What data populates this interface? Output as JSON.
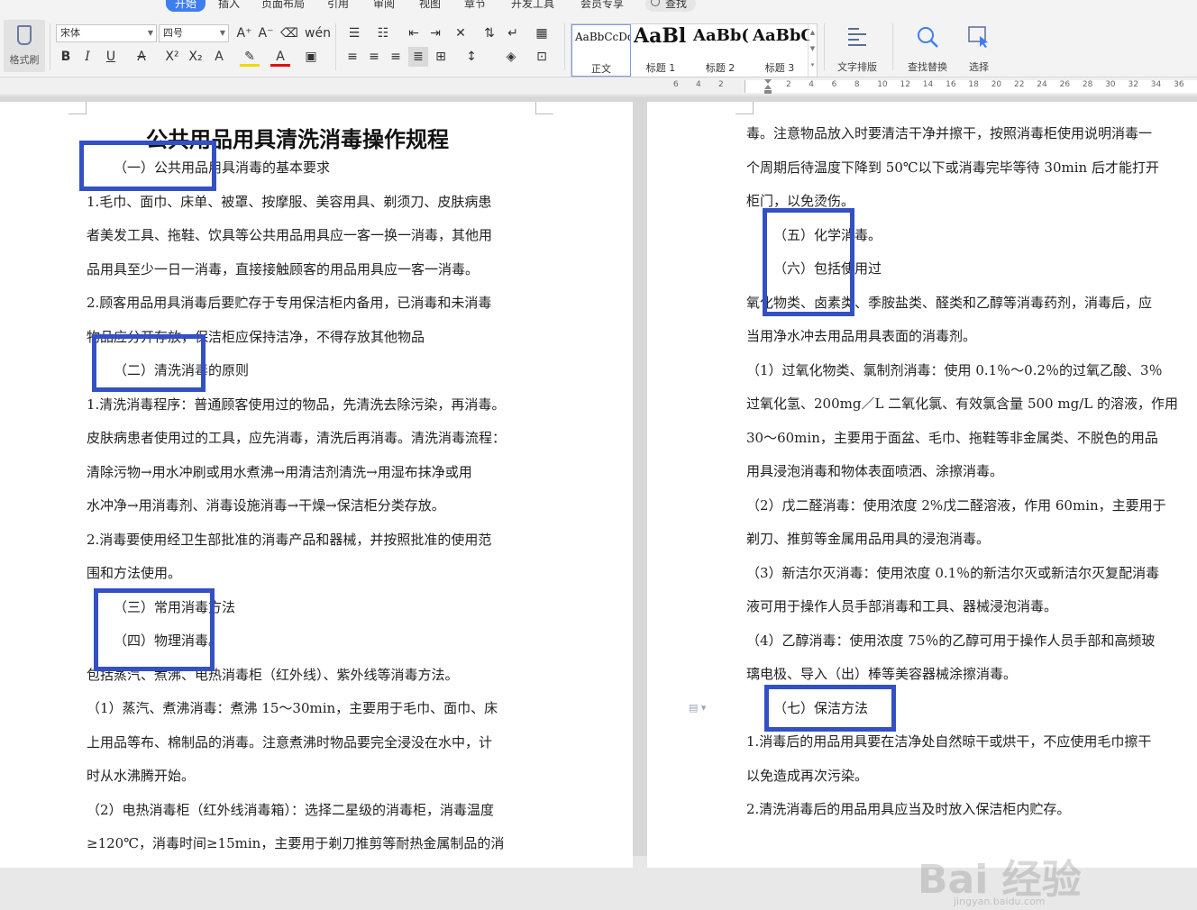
{
  "menu": {
    "tabs": [
      "开始",
      "插入",
      "页面布局",
      "引用",
      "审阅",
      "视图",
      "章节",
      "开发工具",
      "会员专享"
    ],
    "active_tab": "开始",
    "search_label": "查找"
  },
  "ribbon": {
    "format_painter": "格式刷",
    "font_name": "宋体",
    "font_size": "四号",
    "styles": [
      {
        "sample": "AaBbCcDd",
        "name": "正文"
      },
      {
        "sample": "AaBl",
        "name": "标题 1"
      },
      {
        "sample": "AaBb(",
        "name": "标题 2"
      },
      {
        "sample": "AaBbC",
        "name": "标题 3"
      }
    ],
    "text_layout": "文字排版",
    "find_replace": "查找替换",
    "select": "选择"
  },
  "ruler": {
    "left_numbers": [
      "6",
      "4",
      "2"
    ],
    "right_numbers": [
      "2",
      "4",
      "6",
      "8",
      "10",
      "12",
      "14",
      "16",
      "18",
      "20",
      "22",
      "24",
      "26",
      "28",
      "30",
      "32",
      "34",
      "36",
      "38"
    ]
  },
  "doc": {
    "title": "公共用品用具清洗消毒操作规程",
    "left_lines": [
      "（一）公共用品用具消毒的基本要求",
      "1.毛巾、面巾、床单、被罩、按摩服、美容用具、剃须刀、皮肤病患",
      "者美发工具、拖鞋、饮具等公共用品用具应一客一换一消毒，其他用",
      "品用具至少一日一消毒，直接接触顾客的用品用具应一客一消毒。",
      "2.顾客用品用具消毒后要贮存于专用保洁柜内备用，已消毒和未消毒",
      "物品应分开存放，保洁柜应保持洁净，不得存放其他物品",
      "（二）清洗消毒的原则",
      "1.清洗消毒程序：普通顾客使用过的物品，先清洗去除污染，再消毒。",
      "皮肤病患者使用过的工具，应先消毒，清洗后再消毒。清洗消毒流程：",
      "清除污物→用水冲刷或用水煮沸→用清洁剂清洗→用湿布抹净或用",
      "水冲净→用消毒剂、消毒设施消毒→干燥→保洁柜分类存放。",
      "2.消毒要使用经卫生部批准的消毒产品和器械，并按照批准的使用范",
      "围和方法使用。",
      "（三）常用消毒方法",
      "（四）物理消毒。",
      "包括蒸汽、煮沸、电热消毒柜（红外线）、紫外线等消毒方法。",
      "（1）蒸汽、煮沸消毒：煮沸 15～30min，主要用于毛巾、面巾、床",
      "上用品等布、棉制品的消毒。注意煮沸时物品要完全浸没在水中，计",
      "时从水沸腾开始。",
      "（2）电热消毒柜（红外线消毒箱）：选择二星级的消毒柜，消毒温度",
      "≥120℃，消毒时间≥15min，主要用于剃刀推剪等耐热金属制品的消"
    ],
    "right_lines": [
      "毒。注意物品放入时要清洁干净并擦干，按照消毒柜使用说明消毒一",
      "个周期后待温度下降到 50℃以下或消毒完毕等待 30min 后才能打开",
      "柜门，以免烫伤。",
      "（五）化学消毒。",
      "（六）包括使用过",
      "氧化物类、卤素类、季胺盐类、醛类和乙醇等消毒药剂，消毒后，应",
      "当用净水冲去用品用具表面的消毒剂。",
      "（1）过氧化物类、氯制剂消毒：使用 0.1％～0.2％的过氧乙酸、3％",
      "过氧化氢、200mg／L 二氧化氯、有效氯含量 500 mg/L 的溶液，作用",
      "30～60min，主要用于面盆、毛巾、拖鞋等非金属类、不脱色的用品",
      "用具浸泡消毒和物体表面喷洒、涂擦消毒。",
      "（2）戊二醛消毒：使用浓度 2%戊二醛溶液，作用 60min，主要用于",
      "剃刀、推剪等金属用品用具的浸泡消毒。",
      "（3）新洁尔灭消毒：使用浓度 0.1％的新洁尔灭或新洁尔灭复配消毒",
      "液可用于操作人员手部消毒和工具、器械浸泡消毒。",
      "（4）乙醇消毒：使用浓度 75％的乙醇可用于操作人员手部和高频玻",
      "璃电极、导入（出）棒等美容器械涂擦消毒。",
      "（七）保洁方法",
      "1.消毒后的用品用具要在洁净处自然晾干或烘干，不应使用毛巾擦干",
      "以免造成再次污染。",
      "2.清洗消毒后的用品用具应当及时放入保洁柜内贮存。"
    ]
  },
  "watermark": {
    "main": "Bai 经验",
    "sub": "jingyan.baidu.com"
  },
  "colors": {
    "accent": "#3e7ef0",
    "highlight_box": "#3350c4"
  }
}
